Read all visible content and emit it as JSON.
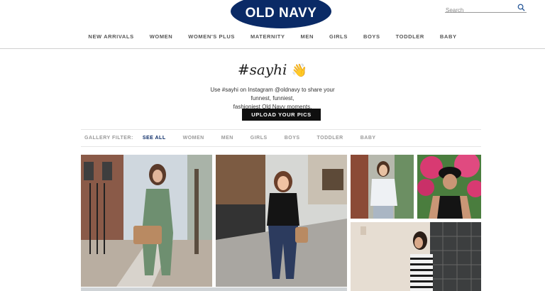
{
  "header": {
    "logo_text": "OLD NAVY",
    "brand_color": "#0a2a66",
    "search_placeholder": "Search"
  },
  "nav": {
    "items": [
      "NEW ARRIVALS",
      "WOMEN",
      "WOMEN'S PLUS",
      "MATERNITY",
      "MEN",
      "GIRLS",
      "BOYS",
      "TODDLER",
      "BABY"
    ]
  },
  "hero": {
    "hashtag": "#sayhi",
    "wave_emoji": "👋",
    "tagline_line1": "Use #sayhi on Instagram @oldnavy to share your funnest, funniest,",
    "tagline_line2": "fashioniest Old Navy moments.",
    "upload_label": "UPLOAD YOUR PICS"
  },
  "filter": {
    "label": "GALLERY FILTER:",
    "options": [
      "SEE ALL",
      "WOMEN",
      "MEN",
      "GIRLS",
      "BOYS",
      "TODDLER",
      "BABY"
    ],
    "active": "SEE ALL"
  },
  "gallery": {
    "photos": [
      "photo-woman-green-jumpsuit",
      "photo-woman-black-top-jeans",
      "photo-woman-white-top",
      "photo-woman-black-cap",
      "photo-woman-striped-shirt"
    ]
  }
}
